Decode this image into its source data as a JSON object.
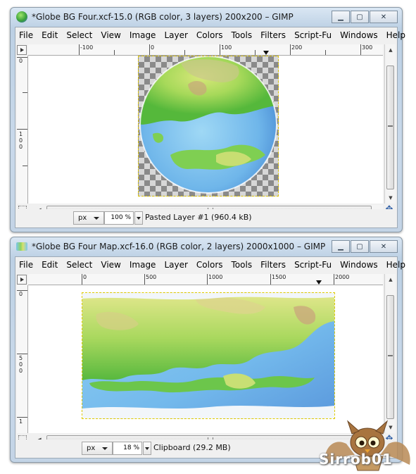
{
  "window1": {
    "title": "*Globe BG Four.xcf-15.0 (RGB color, 3 layers) 200x200 – GIMP",
    "menu": [
      "File",
      "Edit",
      "Select",
      "View",
      "Image",
      "Layer",
      "Colors",
      "Tools",
      "Filters",
      "Script-Fu",
      "Windows",
      "Help"
    ],
    "hruler_labels": [
      "-100",
      "0",
      "100",
      "200",
      "300"
    ],
    "vruler_labels": [
      "0",
      "1",
      "0",
      "0"
    ],
    "unit": "px",
    "zoom": "100 %",
    "status": "Pasted Layer #1 (960.4 kB)"
  },
  "window2": {
    "title": "*Globe BG Four Map.xcf-16.0 (RGB color, 2 layers) 2000x1000 – GIMP",
    "menu": [
      "File",
      "Edit",
      "Select",
      "View",
      "Image",
      "Layer",
      "Colors",
      "Tools",
      "Filters",
      "Script-Fu",
      "Windows",
      "Help"
    ],
    "hruler_labels": [
      "0",
      "500",
      "1000",
      "1500",
      "2000"
    ],
    "vruler_labels": [
      "0",
      "5",
      "0",
      "0",
      "1"
    ],
    "unit": "px",
    "zoom": "18 %",
    "status": "Clipboard (29.2 MB)"
  },
  "watermark": "Sirrob01",
  "icons": {
    "minimize": "minimize-icon",
    "maximize": "maximize-icon",
    "close": "close-icon",
    "navigate": "navigate-icon"
  }
}
